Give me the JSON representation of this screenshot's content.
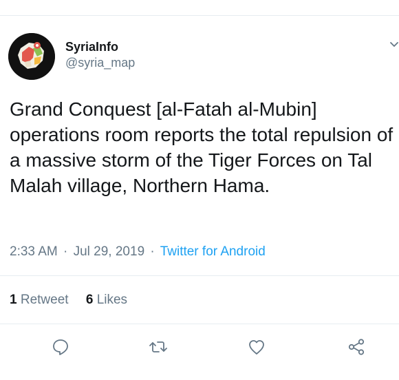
{
  "tweet": {
    "author": {
      "display_name": "SyriaInfo",
      "handle": "@syria_map"
    },
    "text": "Grand Conquest [al-Fatah al-Mubin] operations room reports the total repulsion of a massive storm of the Tiger Forces on Tal Malah village, Northern Hama.",
    "time": "2:33 AM",
    "date": "Jul 29, 2019",
    "separator": "·",
    "source": "Twitter for Android",
    "retweets": {
      "count": "1",
      "label": "Retweet"
    },
    "likes": {
      "count": "6",
      "label": "Likes"
    }
  },
  "actions": {
    "reply_icon": "speech-bubble-icon",
    "retweet_icon": "retweet-arrows-icon",
    "like_icon": "heart-icon",
    "share_icon": "share-nodes-icon"
  },
  "colors": {
    "text": "#14171a",
    "secondary": "#657786",
    "link": "#1da1f2",
    "divider": "#e6ecf0"
  }
}
